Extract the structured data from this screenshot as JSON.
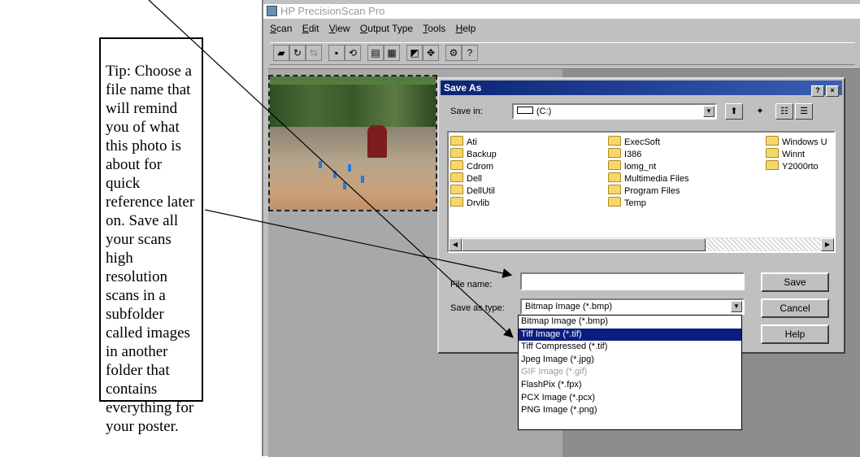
{
  "tip": {
    "text": "Tip: Choose a file name that will remind you of what this photo is about for quick reference later on. Save all your scans high resolution scans in a subfolder called images in another folder that contains everything for your poster."
  },
  "app": {
    "title": "HP PrecisionScan Pro",
    "menu": [
      {
        "key": "S",
        "rest": "can"
      },
      {
        "key": "E",
        "rest": "dit"
      },
      {
        "key": "V",
        "rest": "iew"
      },
      {
        "key": "O",
        "rest": "utput Type"
      },
      {
        "key": "T",
        "rest": "ools"
      },
      {
        "key": "H",
        "rest": "elp"
      }
    ]
  },
  "dialog": {
    "title": "Save As",
    "help_btn": "?",
    "close_btn": "×",
    "save_in_label": "Save in:",
    "save_in_value": "(C:)",
    "files_col1": [
      "Ati",
      "Backup",
      "Cdrom",
      "Dell",
      "DellUtil",
      "Drvlib"
    ],
    "files_col2": [
      "ExecSoft",
      "I386",
      "lomg_nt",
      "Multimedia Files",
      "Program Files",
      "Temp"
    ],
    "files_col3": [
      "Windows U",
      "Winnt",
      "Y2000rto"
    ],
    "file_name_label": "File name:",
    "file_name_value": "",
    "save_as_type_label": "Save as type:",
    "save_as_type_value": "Bitmap Image (*.bmp)",
    "buttons": {
      "save": "Save",
      "cancel": "Cancel",
      "help": "Help"
    },
    "type_options": [
      "Bitmap Image (*.bmp)",
      "Tiff Image (*.tif)",
      "Tiff Compressed (*.tif)",
      "Jpeg Image (*.jpg)",
      "GIF Image (*.gif)",
      "FlashPix (*.fpx)",
      "PCX Image (*.pcx)",
      "PNG Image (*.png)"
    ],
    "selected_option": "Tiff Image (*.tif)",
    "disabled_option": "GIF Image (*.gif)"
  }
}
